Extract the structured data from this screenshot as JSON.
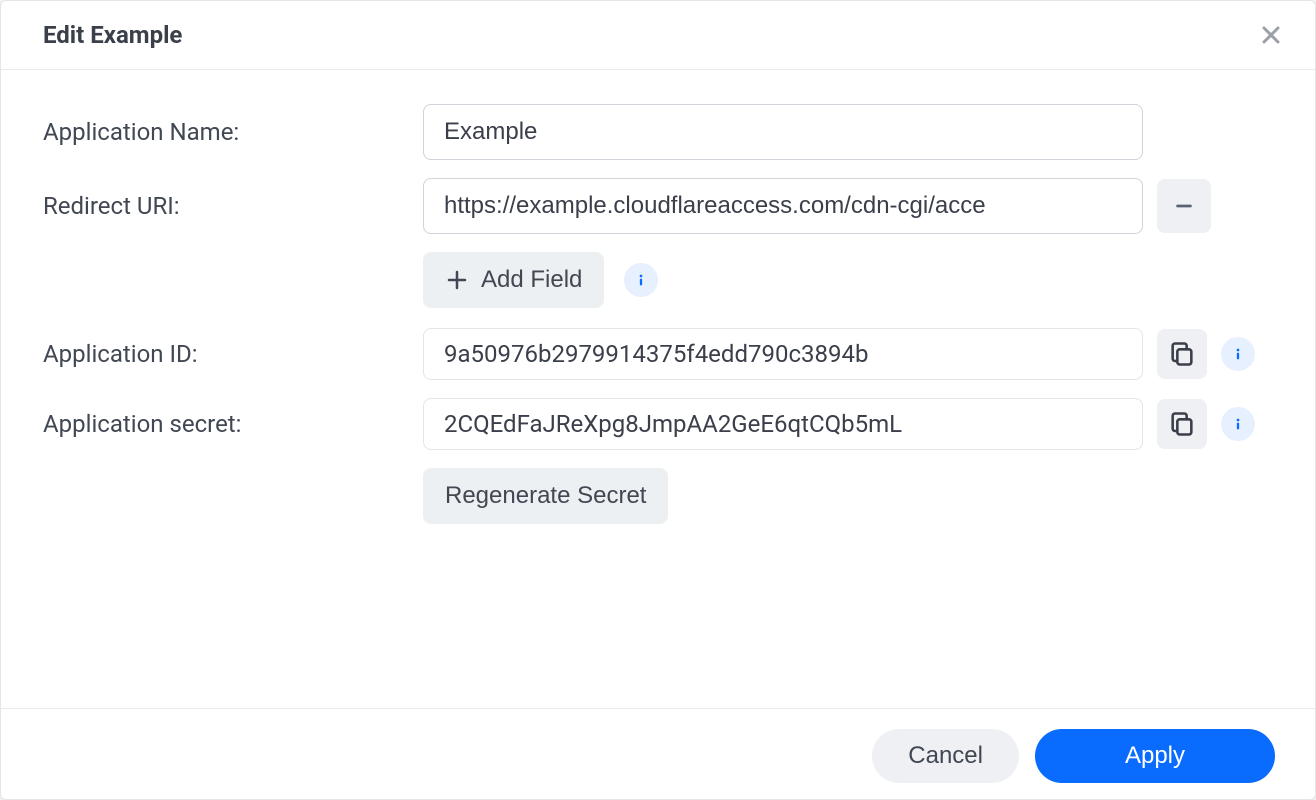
{
  "dialog": {
    "title": "Edit Example",
    "labels": {
      "app_name": "Application Name:",
      "redirect_uri": "Redirect URI:",
      "app_id": "Application ID:",
      "app_secret": "Application secret:"
    },
    "values": {
      "app_name": "Example",
      "redirect_uri": "https://example.cloudflareaccess.com/cdn-cgi/acce",
      "app_id": "9a50976b2979914375f4edd790c3894b",
      "app_secret": "2CQEdFaJReXpg8JmpAA2GeE6qtCQb5mL"
    },
    "buttons": {
      "add_field": "Add Field",
      "regenerate": "Regenerate Secret",
      "cancel": "Cancel",
      "apply": "Apply"
    }
  }
}
